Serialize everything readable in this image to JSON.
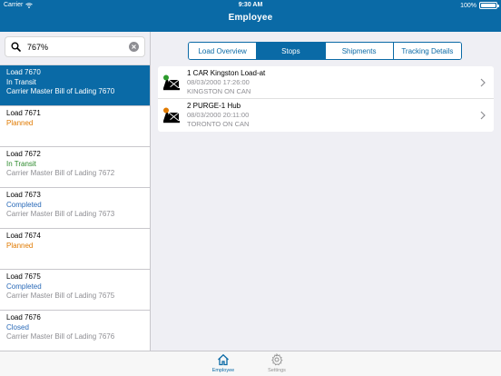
{
  "status": {
    "carrier": "Carrier",
    "time": "9:30 AM",
    "battery": "100%"
  },
  "nav": {
    "title": "Employee"
  },
  "search": {
    "value": "767%"
  },
  "loads": [
    {
      "title": "Load 7670",
      "status": "In Transit",
      "status_kind": "transit",
      "desc": "Carrier Master Bill of Lading 7670",
      "selected": true
    },
    {
      "title": "Load 7671",
      "status": "Planned",
      "status_kind": "planned",
      "desc": "",
      "selected": false
    },
    {
      "title": "Load 7672",
      "status": "In Transit",
      "status_kind": "transit",
      "desc": "Carrier Master Bill of Lading 7672",
      "selected": false
    },
    {
      "title": "Load 7673",
      "status": "Completed",
      "status_kind": "completed",
      "desc": "Carrier Master Bill of Lading 7673",
      "selected": false
    },
    {
      "title": "Load 7674",
      "status": "Planned",
      "status_kind": "planned",
      "desc": "",
      "selected": false
    },
    {
      "title": "Load 7675",
      "status": "Completed",
      "status_kind": "completed",
      "desc": "Carrier Master Bill of Lading 7675",
      "selected": false
    },
    {
      "title": "Load 7676",
      "status": "Closed",
      "status_kind": "closed",
      "desc": "Carrier Master Bill of Lading 7676",
      "selected": false
    }
  ],
  "tabs": [
    "Load Overview",
    "Stops",
    "Shipments",
    "Tracking Details"
  ],
  "active_tab": "Stops",
  "stops": [
    {
      "title": "1 CAR Kingston Load-at",
      "datetime": "08/03/2000 17:26:00",
      "location": "KINGSTON ON CAN",
      "badge_color": "#2c9a2c"
    },
    {
      "title": "2 PURGE-1 Hub",
      "datetime": "08/03/2000 20:11:00",
      "location": "TORONTO ON CAN",
      "badge_color": "#e07a00"
    }
  ],
  "tabbar": {
    "employee": "Employee",
    "settings": "Settings"
  },
  "colors": {
    "accent": "#0a6aa6",
    "in_transit": "#2c8a2c",
    "planned": "#e07a00",
    "completed": "#2a6ab8"
  },
  "icons": {
    "search": "search-icon",
    "clear": "clear-icon",
    "chevron": "chevron-right-icon",
    "home": "home-icon",
    "settings": "gear-icon",
    "wifi": "wifi-icon",
    "battery": "battery-icon"
  }
}
